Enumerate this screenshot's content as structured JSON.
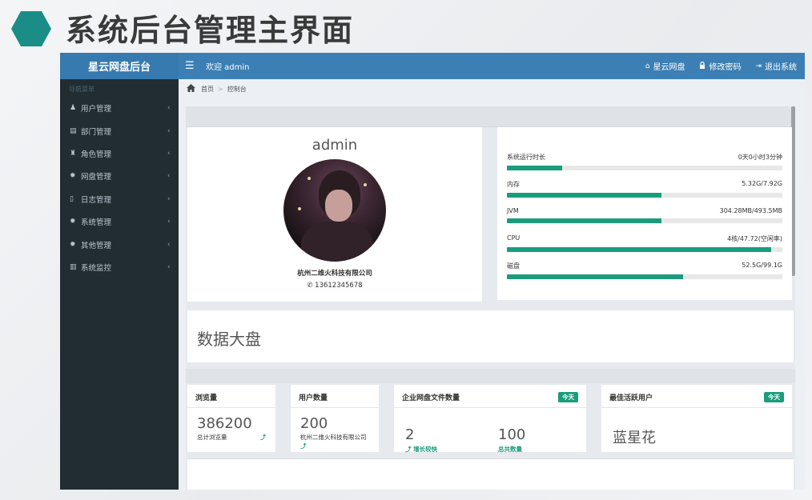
{
  "slide": {
    "title": "系统后台管理主界面",
    "hex_color": "#1a8d86"
  },
  "topbar": {
    "brand": "星云网盘后台",
    "menu_icon": "☰",
    "welcome": "欢迎 admin",
    "links": [
      {
        "icon": "home-icon",
        "glyph": "⌂",
        "label": "星云网盘"
      },
      {
        "icon": "lock-icon",
        "glyph": "🔒",
        "label": "修改密码"
      },
      {
        "icon": "logout-icon",
        "glyph": "⇥",
        "label": "退出系统"
      }
    ]
  },
  "sidebar": {
    "header": "导航菜单",
    "items": [
      {
        "icon": "user-icon",
        "glyph": "♟",
        "label": "用户管理"
      },
      {
        "icon": "id-card-icon",
        "glyph": "▤",
        "label": "部门管理"
      },
      {
        "icon": "role-icon",
        "glyph": "♜",
        "label": "角色管理"
      },
      {
        "icon": "gear-icon",
        "glyph": "✹",
        "label": "网盘管理"
      },
      {
        "icon": "file-icon",
        "glyph": "▯",
        "label": "日志管理"
      },
      {
        "icon": "gear-icon",
        "glyph": "✹",
        "label": "系统管理"
      },
      {
        "icon": "gear-icon",
        "glyph": "✹",
        "label": "其他管理"
      },
      {
        "icon": "bar-chart-icon",
        "glyph": "▥",
        "label": "系统监控"
      }
    ],
    "chevron": "‹"
  },
  "breadcrumb": {
    "home": "首页",
    "separator": ">",
    "current": "控制台"
  },
  "profile": {
    "name": "admin",
    "company": "杭州二维火科技有限公司",
    "phone": "13612345678"
  },
  "status": [
    {
      "label": "系统运行时长",
      "value": "0天0小时3分钟",
      "percent": 20
    },
    {
      "label": "内存",
      "value": "5.32G/7.92G",
      "percent": 56
    },
    {
      "label": "JVM",
      "value": "304.28MB/493.5MB",
      "percent": 56
    },
    {
      "label": "CPU",
      "value": "4核/47.72(空闲率)",
      "percent": 96
    },
    {
      "label": "磁盘",
      "value": "52.5G/99.1G",
      "percent": 64
    }
  ],
  "dashboard": {
    "title": "数据大盘",
    "today_tag": "今天",
    "views": {
      "title": "浏览量",
      "value": "386200",
      "sub": "总计浏览量"
    },
    "users": {
      "title": "用户数量",
      "value": "200",
      "sub": "杭州二维火科技有限公司"
    },
    "files": {
      "title": "企业网盘文件数量",
      "growth": "2",
      "growth_label": "增长较快",
      "total": "100",
      "total_label": "总共数量"
    },
    "best": {
      "title": "最佳活跃用户",
      "value": "蓝星花"
    }
  },
  "colors": {
    "topbar": "#3c7fb4",
    "sidebar": "#222d32",
    "accent": "#1a9c7d"
  }
}
